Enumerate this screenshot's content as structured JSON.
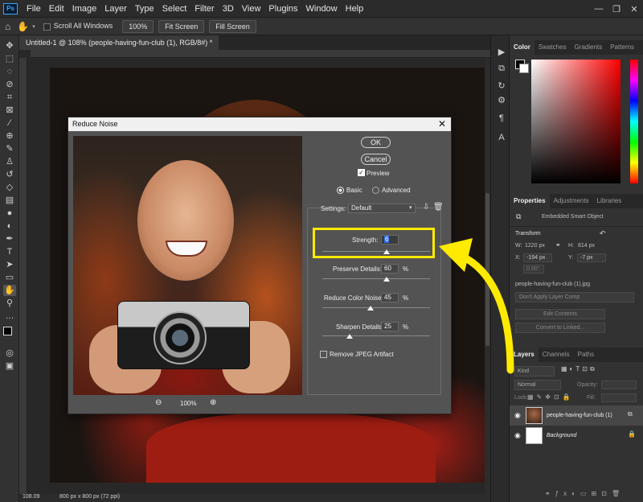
{
  "app": {
    "logo": "Ps",
    "menu": [
      "File",
      "Edit",
      "Image",
      "Layer",
      "Type",
      "Select",
      "Filter",
      "3D",
      "View",
      "Plugins",
      "Window",
      "Help"
    ],
    "window_controls": [
      "—",
      "❐",
      "✕"
    ]
  },
  "options_bar": {
    "scroll_all_windows": "Scroll All Windows",
    "zoom_value": "100%",
    "fit_screen": "Fit Screen",
    "fill_screen": "Fill Screen"
  },
  "document": {
    "tab_title": "Untitled-1 @ 108% (people-having-fun-club (1), RGB/8#) *",
    "zoom_status": "108.09",
    "doc_size": "800 px x 800 px (72 ppi)"
  },
  "dialog": {
    "title": "Reduce Noise",
    "close": "✕",
    "ok": "OK",
    "cancel": "Cancel",
    "preview_label": "Preview",
    "preview_checked": true,
    "mode_basic": "Basic",
    "mode_advanced": "Advanced",
    "settings_label": "Settings:",
    "settings_value": "Default",
    "strength_label": "Strength:",
    "strength_value": "6",
    "preserve_details_label": "Preserve Details:",
    "preserve_details_value": "60",
    "reduce_color_noise_label": "Reduce Color Noise:",
    "reduce_color_noise_value": "45",
    "sharpen_details_label": "Sharpen Details:",
    "sharpen_details_value": "25",
    "percent": "%",
    "remove_jpeg_label": "Remove JPEG Artifact",
    "preview_zoom": "100%",
    "slider_levels": {
      "strength": 0.6,
      "preserve_details": 0.6,
      "reduce_color_noise": 0.45,
      "sharpen_details": 0.25
    }
  },
  "annotation": {
    "highlight_color": "#ffea00"
  },
  "panels": {
    "color_tabs": [
      "Color",
      "Swatches",
      "Gradients",
      "Patterns"
    ],
    "properties_tabs": [
      "Properties",
      "Adjustments",
      "Libraries"
    ],
    "smart_object_label": "Embedded Smart Object",
    "transform_label": "Transform",
    "w_label": "W:",
    "w_value": "1220 px",
    "h_label": "H:",
    "h_value": "814 px",
    "x_label": "X:",
    "x_value": "-194 px",
    "y_label": "Y:",
    "y_value": "-7 px",
    "angle_value": "0.00°",
    "linked_file": "people-having-fun-club (1).jpg",
    "layer_comp": "Don't Apply Layer Comp",
    "edit_contents": "Edit Contents",
    "convert_linked": "Convert to Linked...",
    "layers_tabs": [
      "Layers",
      "Channels",
      "Paths"
    ],
    "kind_label": "Kind",
    "blend_mode": "Normal",
    "opacity_label": "Opacity:",
    "lock_label": "Lock:",
    "fill_label": "Fill:",
    "layers": [
      {
        "name": "people-having-fun-club (1)"
      },
      {
        "name": "Background"
      }
    ]
  }
}
